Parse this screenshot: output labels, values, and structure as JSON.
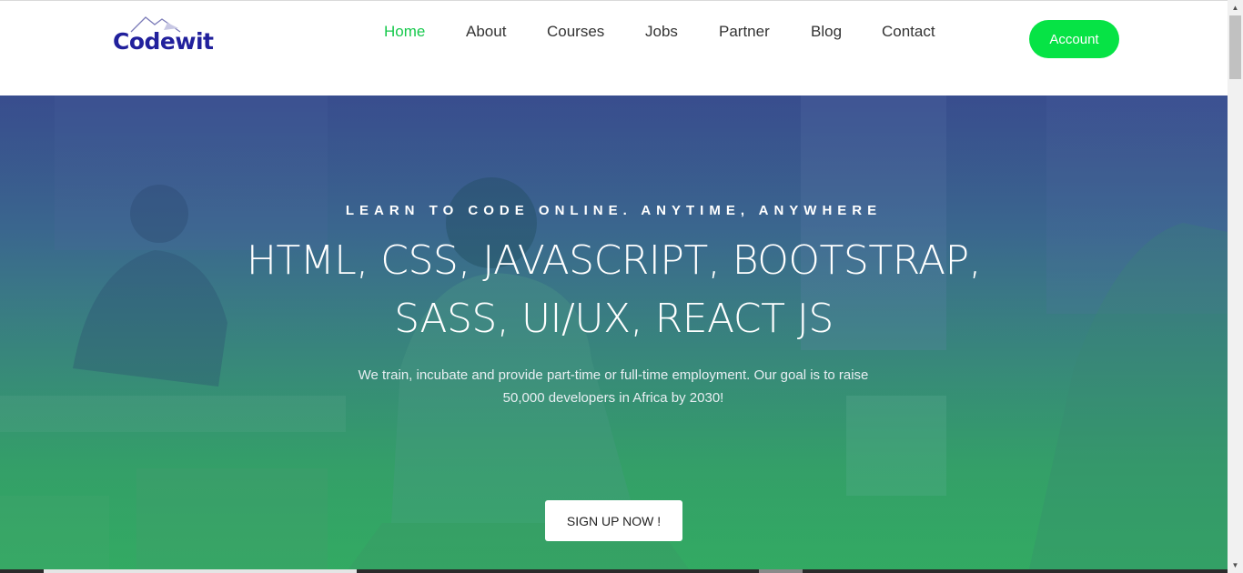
{
  "brand": {
    "name": "Codewit",
    "color": "#21209c"
  },
  "nav": {
    "items": [
      {
        "label": "Home",
        "active": true
      },
      {
        "label": "About"
      },
      {
        "label": "Courses"
      },
      {
        "label": "Jobs"
      },
      {
        "label": "Partner"
      },
      {
        "label": "Blog"
      },
      {
        "label": "Contact"
      }
    ],
    "active_color": "#18c94d"
  },
  "account_button": {
    "label": "Account",
    "color": "#06e345"
  },
  "hero": {
    "tagline": "LEARN TO CODE ONLINE. ANYTIME, ANYWHERE",
    "title_line1": "HTML, CSS, JAVASCRIPT, BOOTSTRAP,",
    "title_line2": "SASS, UI/UX, REACT JS",
    "subtitle": "We train, incubate and provide part-time or full-time employment. Our goal is to raise 50,000 developers in Africa by 2030!",
    "cta_label": "SIGN UP NOW !",
    "gradient_top": "#3a4f8c",
    "gradient_bottom": "#38ad64"
  },
  "icons": {
    "scroll_up": "arrow-up-icon",
    "scroll_down": "arrow-down-icon"
  }
}
